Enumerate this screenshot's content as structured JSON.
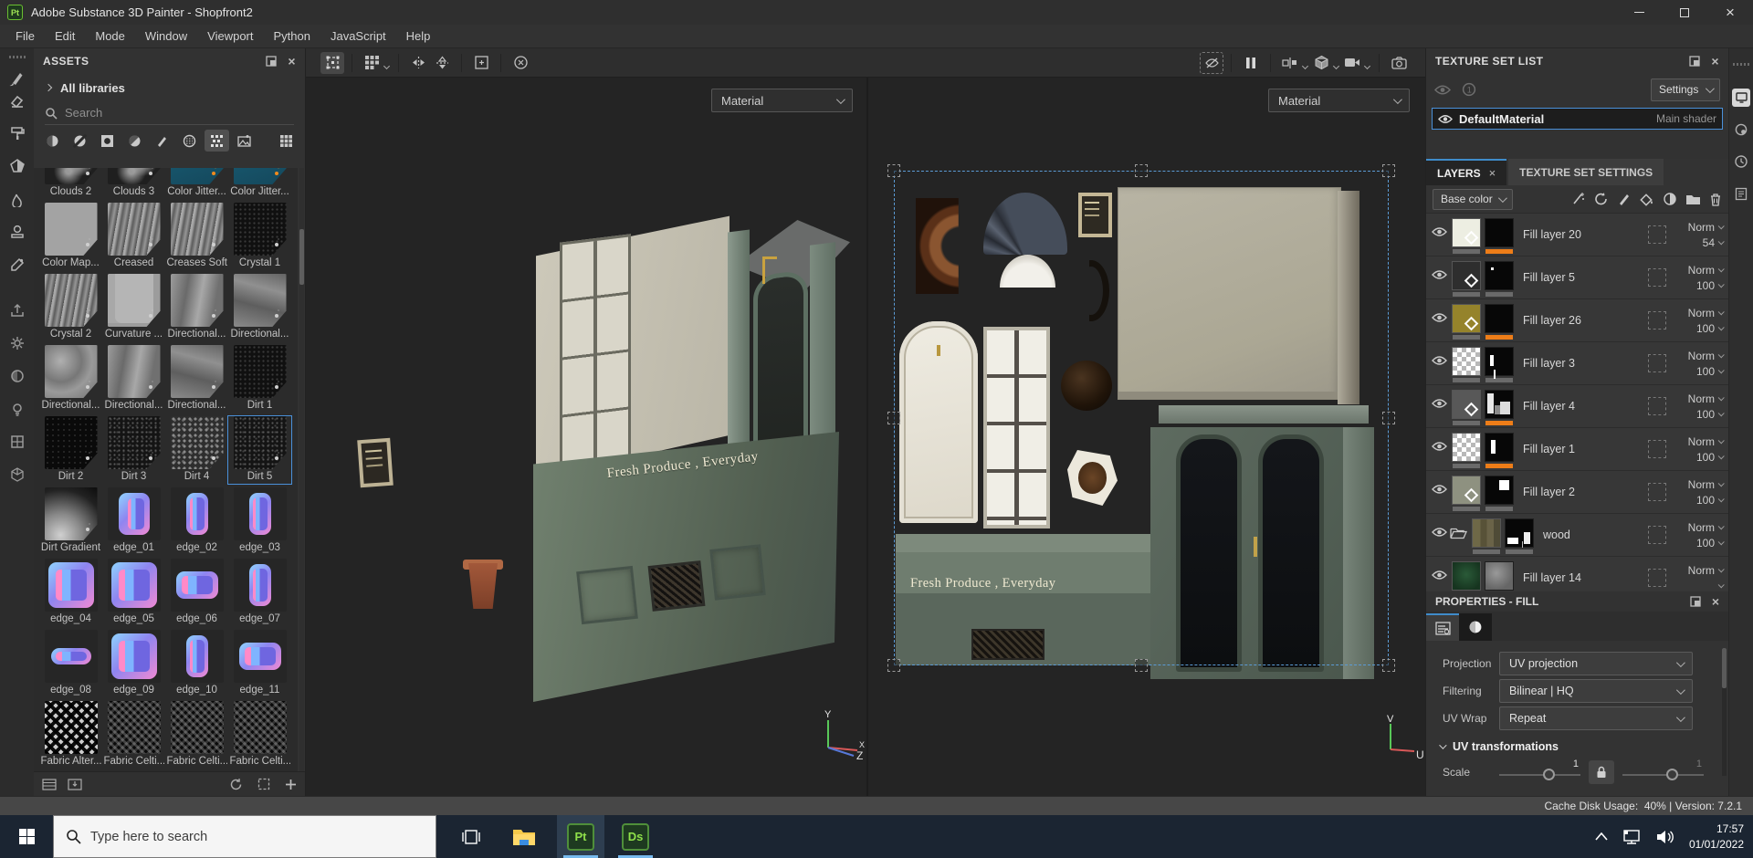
{
  "titlebar": {
    "app_badge": "Pt",
    "title": "Adobe Substance 3D Painter - Shopfront2"
  },
  "menubar": {
    "items": [
      "File",
      "Edit",
      "Mode",
      "Window",
      "Viewport",
      "Python",
      "JavaScript",
      "Help"
    ]
  },
  "tool_strip": {
    "icons": [
      "paint-brush-tool",
      "eraser-tool",
      "paint-roller-tool",
      "polygon-fill-tool",
      "smudge-tool",
      "clone-stamp-tool",
      "material-picker-tool",
      "export-resources",
      "settings-gear",
      "material-sphere",
      "lighting",
      "texture-view",
      "cube-view"
    ]
  },
  "assets_panel": {
    "title": "ASSETS",
    "library_label": "All libraries",
    "search_placeholder": "Search",
    "filter_icons": [
      "materials-filter",
      "smart-materials-filter",
      "smart-masks-filter",
      "filters-filter",
      "brushes-filter",
      "alphas-filter",
      "textures-filter",
      "environments-filter",
      "grid-view"
    ],
    "active_filter": "textures-filter",
    "selected_asset": "Dirt 5",
    "assets": [
      {
        "label": "Clouds 2",
        "kind": "cloud"
      },
      {
        "label": "Clouds 3",
        "kind": "cloud"
      },
      {
        "label": "Color Jitter...",
        "kind": "teal"
      },
      {
        "label": "Color Jitter...",
        "kind": "teal"
      },
      {
        "label": "Color Map...",
        "kind": "flat"
      },
      {
        "label": "Creased",
        "kind": "wavy"
      },
      {
        "label": "Creases Soft",
        "kind": "wavy"
      },
      {
        "label": "Crystal 1",
        "kind": "darknoise"
      },
      {
        "label": "Crystal 2",
        "kind": "wavy"
      },
      {
        "label": "Curvature ...",
        "kind": "curvature"
      },
      {
        "label": "Directional...",
        "kind": "noise-b"
      },
      {
        "label": "Directional...",
        "kind": "noise-c"
      },
      {
        "label": "Directional...",
        "kind": "noise-a"
      },
      {
        "label": "Directional...",
        "kind": "noise-b"
      },
      {
        "label": "Directional...",
        "kind": "noise-c"
      },
      {
        "label": "Dirt 1",
        "kind": "darknoise"
      },
      {
        "label": "Dirt 2",
        "kind": "vdark"
      },
      {
        "label": "Dirt 3",
        "kind": "speckle"
      },
      {
        "label": "Dirt 4",
        "kind": "blotch"
      },
      {
        "label": "Dirt 5",
        "kind": "speckle",
        "selected": true
      },
      {
        "label": "Dirt Gradient",
        "kind": "gradient"
      },
      {
        "label": "edge_01",
        "kind": "nm-open"
      },
      {
        "label": "edge_02",
        "kind": "nm-v"
      },
      {
        "label": "edge_03",
        "kind": "nm-v"
      },
      {
        "label": "edge_04",
        "kind": "nm-sq"
      },
      {
        "label": "edge_05",
        "kind": "nm-sq"
      },
      {
        "label": "edge_06",
        "kind": "nm-wide"
      },
      {
        "label": "edge_07",
        "kind": "nm-v"
      },
      {
        "label": "edge_08",
        "kind": "nm-h"
      },
      {
        "label": "edge_09",
        "kind": "nm-sq"
      },
      {
        "label": "edge_10",
        "kind": "nm-v"
      },
      {
        "label": "edge_11",
        "kind": "nm-wide"
      },
      {
        "label": "Fabric Alter...",
        "kind": "fabric-light"
      },
      {
        "label": "Fabric Celti...",
        "kind": "fabric-dark"
      },
      {
        "label": "Fabric Celti...",
        "kind": "fabric-dark"
      },
      {
        "label": "Fabric Celti...",
        "kind": "fabric-dark"
      }
    ],
    "footer_icons": [
      "shelf-list-view",
      "shelf-import-view",
      "refresh-shelf",
      "frame-thumbnails",
      "add-resource"
    ]
  },
  "viewport": {
    "toolbar_left_icons": [
      "transform-manipulator",
      "tiling-mode",
      "mirror-horizontal",
      "mirror-vertical",
      "frame-selection",
      "reset-transform"
    ],
    "toolbar_right_icons": [
      "hide-gizmos",
      "pause-engine",
      "symmetry",
      "geometry-decal",
      "camera-projection",
      "screenshot-camera"
    ],
    "view_3d": {
      "mode_selector": "Material",
      "sign_text": "Fresh Produce , Everyday",
      "axis_labels": {
        "x": "X",
        "y": "Y",
        "z": "Z"
      }
    },
    "view_2d": {
      "mode_selector": "Material",
      "sign_text": "Fresh Produce , Everyday",
      "axis_labels": {
        "u": "U",
        "v": "V"
      }
    }
  },
  "texture_set_list": {
    "title": "TEXTURE SET LIST",
    "settings_button": "Settings",
    "sets": [
      {
        "name": "DefaultMaterial",
        "shader_label": "Main shader",
        "selected": true
      }
    ]
  },
  "layers_panel": {
    "tabs": [
      {
        "label": "LAYERS",
        "active": true,
        "closable": true
      },
      {
        "label": "TEXTURE SET SETTINGS",
        "active": false
      }
    ],
    "channel_filter": "Base color",
    "toolbar_icons": [
      "add-smart-material",
      "add-effect",
      "add-paint-layer",
      "add-fill-layer",
      "add-smart-mask",
      "add-group",
      "delete-layer"
    ],
    "layers": [
      {
        "name": "Fill layer 20",
        "blend_mode": "Norm",
        "opacity": "54",
        "thumb": "cream",
        "mask": "black",
        "mask_active": true
      },
      {
        "name": "Fill layer 5",
        "blend_mode": "Norm",
        "opacity": "100",
        "thumb": "dark",
        "mask": "black-dot",
        "mask_active": false
      },
      {
        "name": "Fill layer 26",
        "blend_mode": "Norm",
        "opacity": "100",
        "thumb": "olive",
        "mask": "black",
        "mask_active": true
      },
      {
        "name": "Fill layer 3",
        "blend_mode": "Norm",
        "opacity": "100",
        "thumb": "checker",
        "mask": "black-marks",
        "mask_active": false
      },
      {
        "name": "Fill layer 4",
        "blend_mode": "Norm",
        "opacity": "100",
        "thumb": "gray",
        "mask": "window",
        "mask_active": true
      },
      {
        "name": "Fill layer 1",
        "blend_mode": "Norm",
        "opacity": "100",
        "thumb": "checker",
        "mask": "black-bar",
        "mask_active": true
      },
      {
        "name": "Fill layer 2",
        "blend_mode": "Norm",
        "opacity": "100",
        "thumb": "gray-green",
        "mask": "black-square",
        "mask_active": false
      },
      {
        "name": "wood",
        "blend_mode": "Norm",
        "opacity": "100",
        "thumb": "wood",
        "mask": "wood-shapes",
        "folder": true,
        "mask_active": false
      },
      {
        "name": "Fill layer 14",
        "blend_mode": "Norm",
        "thumb": "green",
        "mask": "gray-blotch",
        "partial": true
      }
    ]
  },
  "properties_panel": {
    "title": "PROPERTIES - FILL",
    "fields": [
      {
        "label": "Projection",
        "value": "UV projection"
      },
      {
        "label": "Filtering",
        "value": "Bilinear | HQ"
      },
      {
        "label": "UV Wrap",
        "value": "Repeat"
      }
    ],
    "section_title": "UV transformations",
    "scale": {
      "label": "Scale",
      "value_1": "1",
      "value_2": "1"
    }
  },
  "right_strip": {
    "icons": [
      "display-settings",
      "shader-settings",
      "history",
      "log"
    ]
  },
  "status_bar": {
    "text": "Cache Disk Usage:  40% | Version: 7.2.1"
  },
  "taskbar": {
    "search_placeholder": "Type here to search",
    "apps": [
      "task-view",
      "file-explorer",
      "substance-painter",
      "substance-designer"
    ],
    "painter_badge": "Pt",
    "designer_badge": "Ds",
    "tray_time": "17:57",
    "tray_date": "01/01/2022"
  },
  "colors": {
    "accent_blue": "#3f8cca",
    "selection_blue": "#4a90d9",
    "active_orange": "#ee7d18",
    "taskbar_underline": "#76b9ed",
    "painter_green": "#8fe04a"
  }
}
